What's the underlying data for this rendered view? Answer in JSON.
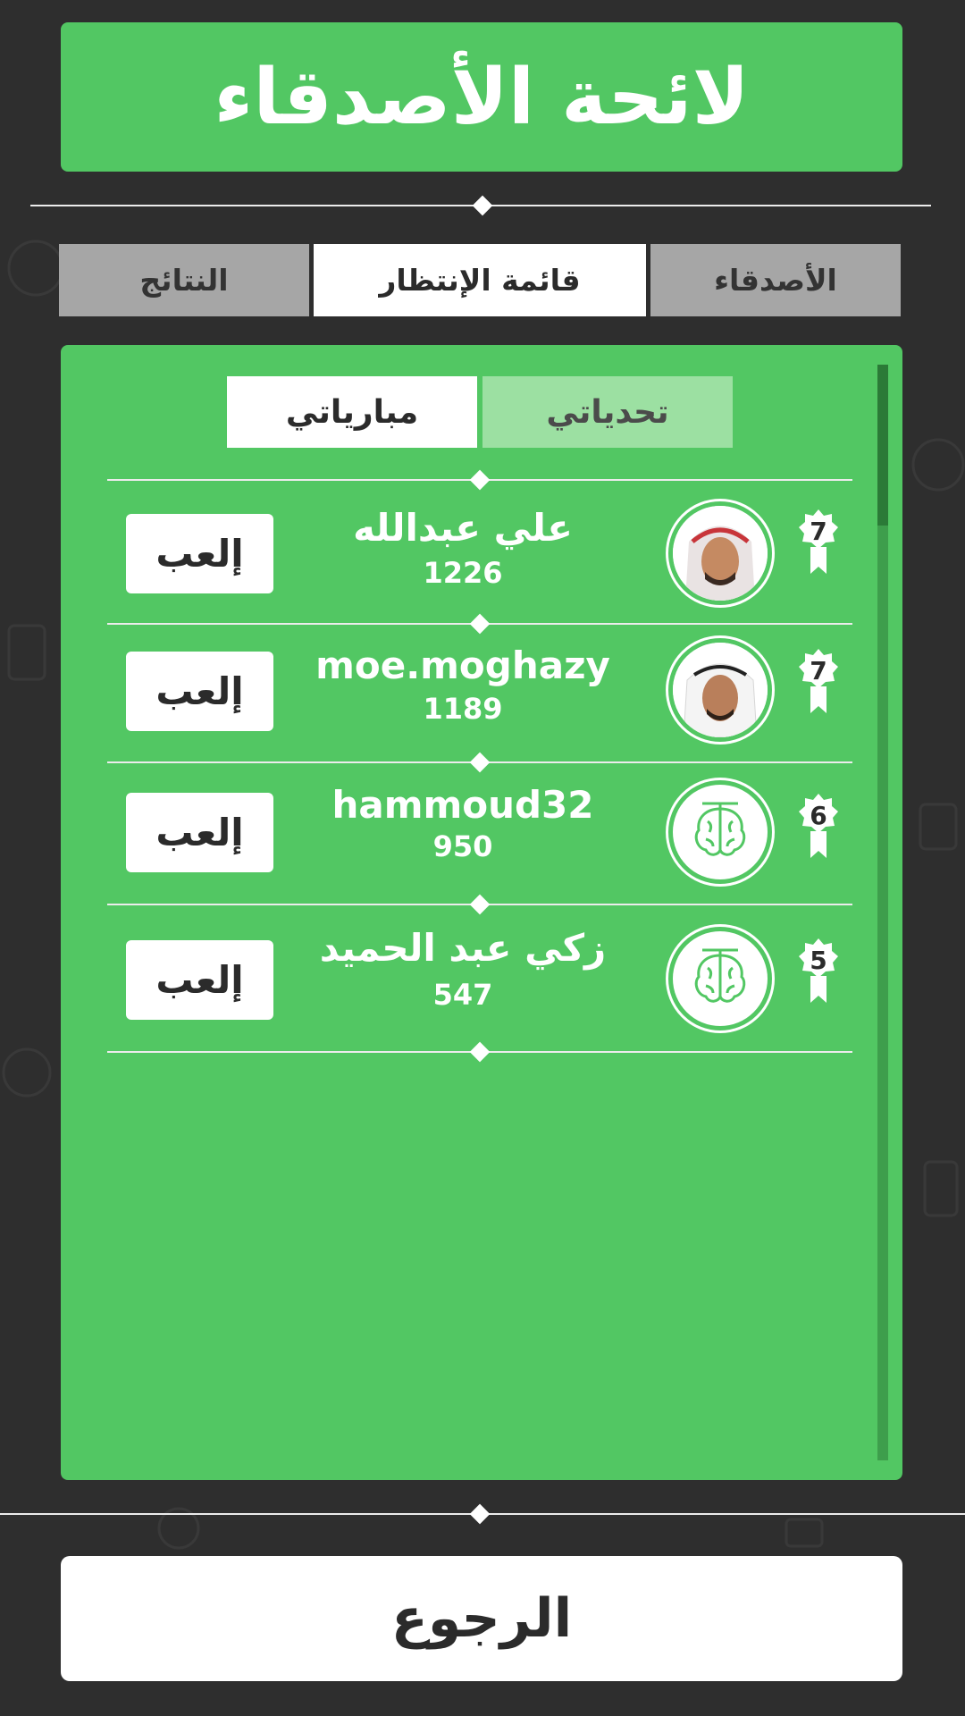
{
  "header": {
    "title": "لائحة الأصدقاء"
  },
  "tabs": [
    {
      "label": "الأصدقاء",
      "active": false
    },
    {
      "label": "قائمة الإنتظار",
      "active": true
    },
    {
      "label": "النتائج",
      "active": false
    }
  ],
  "sub_tabs": [
    {
      "label": "تحدياتي",
      "selected": true
    },
    {
      "label": "مبارياتي",
      "selected": false
    }
  ],
  "players": [
    {
      "name": "علي عبدالله",
      "score": "1226",
      "level": "7",
      "avatar": "photo-keffiyeh",
      "action": "إلعب"
    },
    {
      "name": "moe.moghazy",
      "score": "1189",
      "level": "7",
      "avatar": "photo-ghutra",
      "action": "إلعب"
    },
    {
      "name": "hammoud32",
      "score": "950",
      "level": "6",
      "avatar": "brain-icon",
      "action": "إلعب"
    },
    {
      "name": "زكي عبد الحميد",
      "score": "547",
      "level": "5",
      "avatar": "brain-icon",
      "action": "إلعب"
    }
  ],
  "footer": {
    "back_label": "الرجوع"
  },
  "colors": {
    "background": "#2e2e2e",
    "accent_green": "#52c763",
    "tab_inactive": "#a6a6a6",
    "sub_tab_selected": "#9ce0a2",
    "text_dark": "#2b2b2b"
  }
}
